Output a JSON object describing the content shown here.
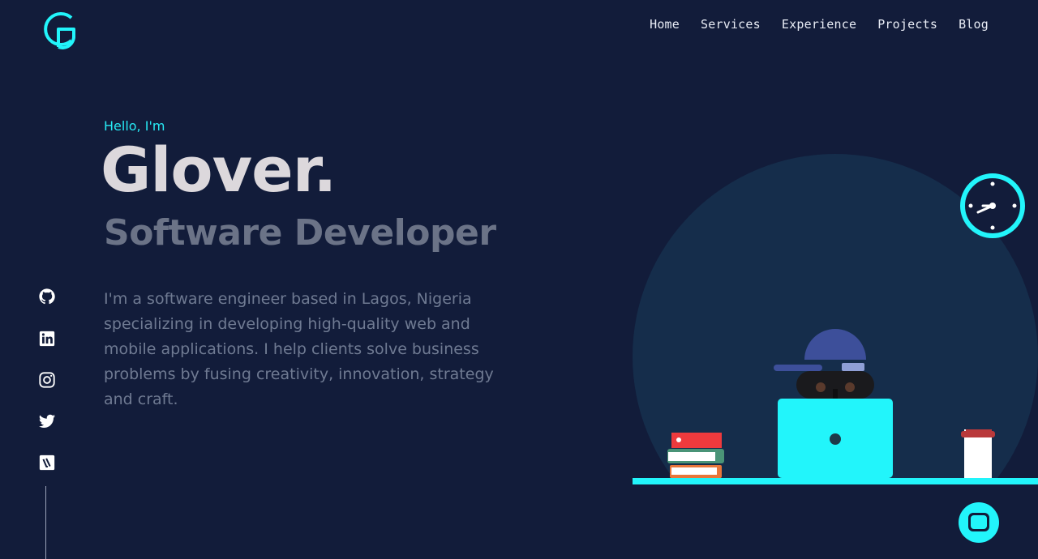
{
  "nav": {
    "items": [
      {
        "label": "Home"
      },
      {
        "label": "Services"
      },
      {
        "label": "Experience"
      },
      {
        "label": "Projects"
      },
      {
        "label": "Blog"
      }
    ]
  },
  "hero": {
    "greeting": "Hello, I'm",
    "name": "Glover.",
    "role": "Software Developer",
    "bio": "I'm a software engineer based in Lagos, Nigeria specializing in developing high-quality web and mobile applications. I help clients solve business problems by fusing creativity, innovation, strategy and craft."
  },
  "social": [
    {
      "icon": "github-icon"
    },
    {
      "icon": "linkedin-icon"
    },
    {
      "icon": "instagram-icon"
    },
    {
      "icon": "twitter-icon"
    },
    {
      "icon": "vimeo-icon"
    }
  ],
  "colors": {
    "background": "#121c3a",
    "accent": "#22f5fb",
    "name": "#dcd8dc",
    "muted": "#6f7a92"
  }
}
